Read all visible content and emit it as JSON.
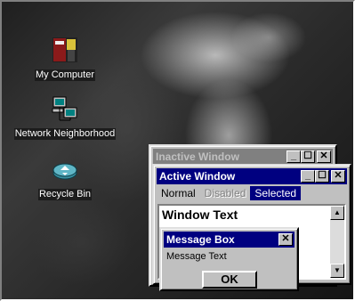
{
  "desktop": {
    "icons": [
      {
        "label": "My Computer",
        "icon": "my-computer-icon"
      },
      {
        "label": "Network Neighborhood",
        "icon": "network-neighborhood-icon"
      },
      {
        "label": "Recycle Bin",
        "icon": "recycle-bin-icon"
      }
    ]
  },
  "inactive_window": {
    "title": "Inactive Window",
    "controls": {
      "minimize": "_",
      "maximize": "☐",
      "close": "✕"
    }
  },
  "active_window": {
    "title": "Active Window",
    "controls": {
      "minimize": "_",
      "maximize": "☐",
      "close": "✕"
    },
    "menu": {
      "normal": "Normal",
      "disabled": "Disabled",
      "selected": "Selected"
    },
    "window_text": "Window Text",
    "scroll": {
      "up": "▲",
      "down": "▼"
    }
  },
  "message_box": {
    "title": "Message Box",
    "close": "✕",
    "text": "Message Text",
    "ok_label": "OK"
  },
  "colors": {
    "active_title": "#000080",
    "inactive_title": "#808080",
    "face": "#c0c0c0"
  }
}
